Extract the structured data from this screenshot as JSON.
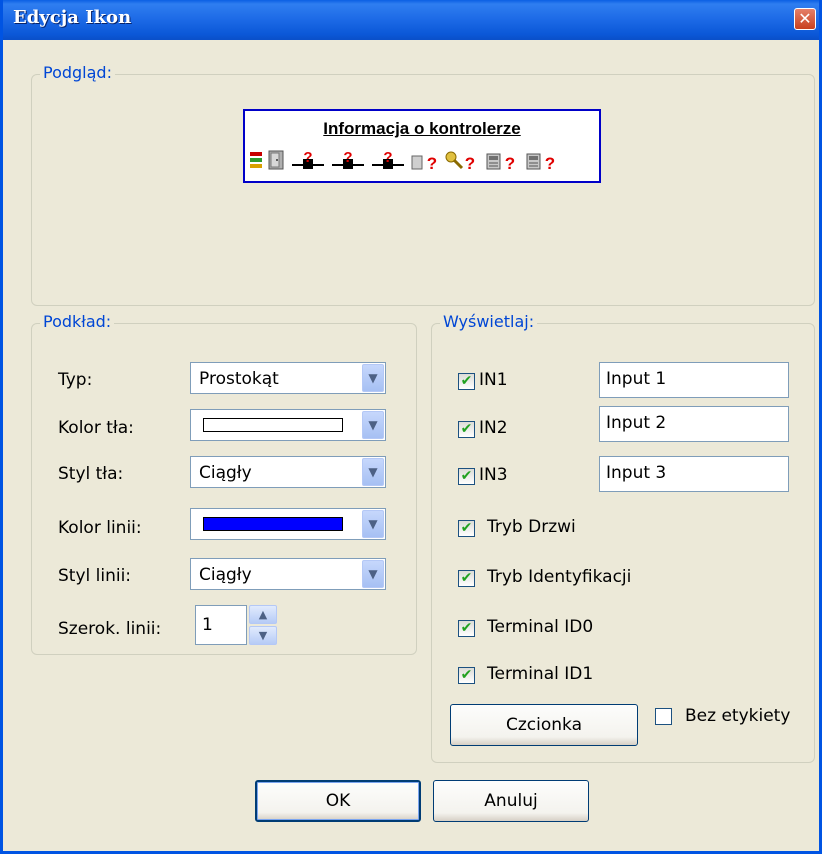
{
  "window": {
    "title": "Edycja Ikon",
    "close_label": "✕"
  },
  "preview": {
    "legend": "Podgląd:",
    "title": "Informacja o kontrolerze",
    "icons": [
      "status-stack-icon",
      "door-icon",
      "input1-unknown-icon",
      "input2-unknown-icon",
      "input3-unknown-icon",
      "door-mode-unknown-icon",
      "key-unknown-icon",
      "terminal0-unknown-icon",
      "terminal1-unknown-icon"
    ],
    "question_mark": "?",
    "colors": {
      "border": "#0000c8",
      "question": "#e00000"
    }
  },
  "background": {
    "legend": "Podkład:",
    "type_label": "Typ:",
    "type_value": "Prostokąt",
    "bg_color_label": "Kolor tła:",
    "bg_color_value": "#ffffff",
    "bg_style_label": "Styl tła:",
    "bg_style_value": "Ciągły",
    "line_color_label": "Kolor linii:",
    "line_color_value": "#0000ff",
    "line_style_label": "Styl linii:",
    "line_style_value": "Ciągły",
    "line_width_label": "Szerok. linii:",
    "line_width_value": "1"
  },
  "display": {
    "legend": "Wyświetlaj:",
    "inputs": [
      {
        "label": "IN1",
        "checked": true,
        "value": "Input 1"
      },
      {
        "label": "IN2",
        "checked": true,
        "value": "Input 2"
      },
      {
        "label": "IN3",
        "checked": true,
        "value": "Input 3"
      }
    ],
    "options": [
      {
        "label": "Tryb Drzwi",
        "checked": true
      },
      {
        "label": "Tryb Identyfikacji",
        "checked": true
      },
      {
        "label": "Terminal ID0",
        "checked": true
      },
      {
        "label": "Terminal ID1",
        "checked": true
      }
    ],
    "font_button": "Czcionka",
    "no_label_checkbox": {
      "label": "Bez etykiety",
      "checked": false
    }
  },
  "buttons": {
    "ok": "OK",
    "cancel": "Anuluj"
  },
  "checkmark": "✔"
}
